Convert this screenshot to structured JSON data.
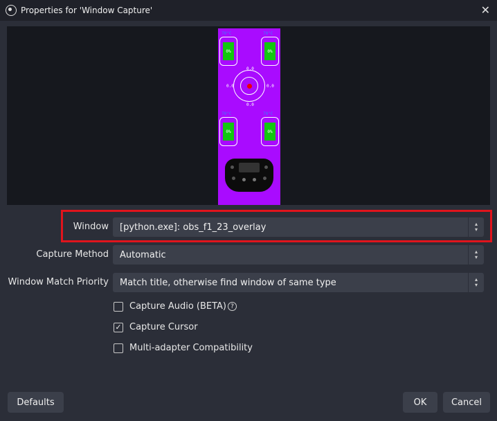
{
  "window": {
    "title": "Properties for 'Window Capture'"
  },
  "overlay": {
    "tire_pct": "0%",
    "tire_temp": "70°C",
    "gforce_values": {
      "top": "0.0",
      "left": "0.0",
      "right": "0.0",
      "bottom": "0.0"
    }
  },
  "fields": {
    "window": {
      "label": "Window",
      "value": "[python.exe]: obs_f1_23_overlay"
    },
    "capture_method": {
      "label": "Capture Method",
      "value": "Automatic"
    },
    "match_priority": {
      "label": "Window Match Priority",
      "value": "Match title, otherwise find window of same type"
    }
  },
  "checkboxes": {
    "capture_audio": {
      "label": "Capture Audio (BETA)",
      "checked": false
    },
    "capture_cursor": {
      "label": "Capture Cursor",
      "checked": true
    },
    "multi_adapter": {
      "label": "Multi-adapter Compatibility",
      "checked": false
    }
  },
  "buttons": {
    "defaults": "Defaults",
    "ok": "OK",
    "cancel": "Cancel"
  },
  "colors": {
    "highlight": "#e0141c",
    "overlay_bg": "#a90bff",
    "tire_fill": "#12c70f"
  }
}
